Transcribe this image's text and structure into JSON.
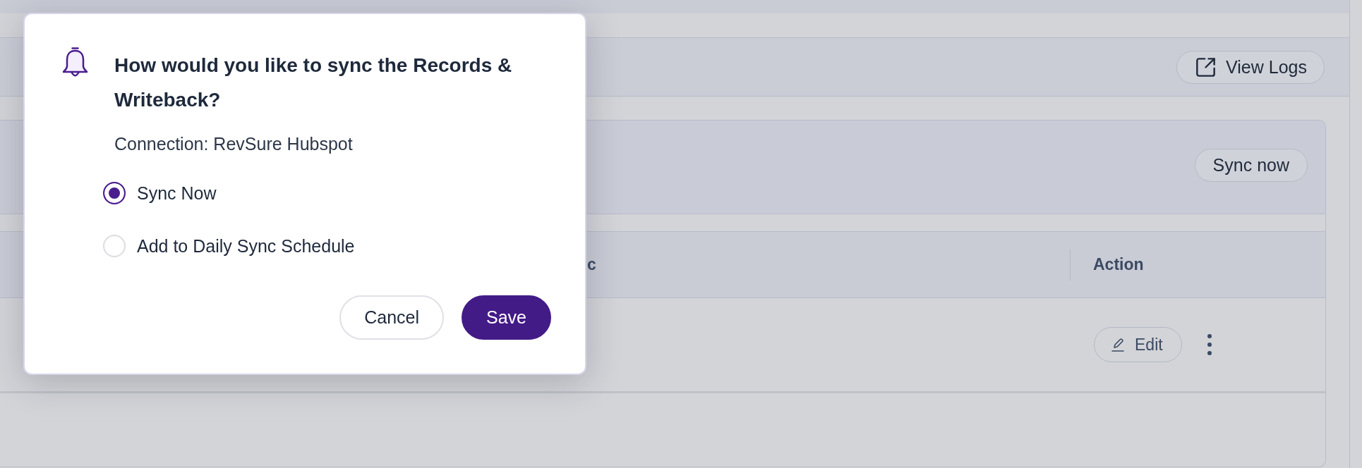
{
  "header_bar": {
    "button": "View Logs"
  },
  "sync_card": {
    "button": "Sync now"
  },
  "table": {
    "columns": [
      {
        "label": "c"
      },
      {
        "label": "Action"
      }
    ],
    "rows": [
      {
        "action": "Edit"
      }
    ]
  },
  "dialog": {
    "title": "How would you like to sync the Records & Writeback?",
    "subtitle": "Connection: RevSure Hubspot",
    "options": [
      {
        "label": "Sync Now",
        "selected": true
      },
      {
        "label": "Add to Daily Sync Schedule",
        "selected": false
      }
    ],
    "buttons": [
      {
        "label": "Cancel",
        "kind": "secondary"
      },
      {
        "label": "Save",
        "kind": "primary"
      }
    ]
  }
}
